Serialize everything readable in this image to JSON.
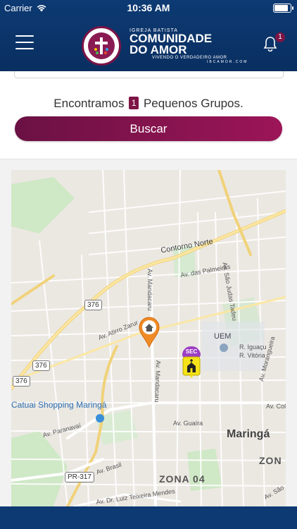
{
  "status_bar": {
    "carrier": "Carrier",
    "time": "10:36 AM",
    "battery_level": 0.95
  },
  "header": {
    "logo": {
      "small_text": "IGREJA BATISTA",
      "line1": "COMUNIDADE",
      "line2": "DO AMOR",
      "tagline": "VIVENDO O VERDADEIRO AMOR",
      "website": "IBCAMOR.COM"
    },
    "notifications_count": "1",
    "colors": {
      "primary": "#0d3a73",
      "accent": "#7d1446"
    }
  },
  "results": {
    "prefix": "Encontramos",
    "count": "1",
    "suffix": "Pequenos Grupos."
  },
  "search_button": {
    "label": "Buscar"
  },
  "map": {
    "labels": {
      "contorno_norte": "Contorno Norte",
      "av_palmeiras": "Av. das Palmeiras",
      "av_sao_judas": "Av. São Judas Tadeu",
      "av_mandacaru1": "Av. Mandacaru",
      "av_mandacaru2": "Av. Mandacaru",
      "av_atirro_zarur": "Av. Atirro Zarur",
      "uem": "UEM",
      "r_iguacu": "R. Iguaçu",
      "r_vitoria": "R. Vitória",
      "av_morangueira": "Av. Morangueira",
      "av_colom": "Av. Colom",
      "catuai": "Catuai Shopping Maringá",
      "av_paranavai": "Av. Paranavaí",
      "av_guaira": "Av. Guaíra",
      "maringa": "Maringá",
      "zona_04": "ZONA 04",
      "zona": "ZON",
      "av_brasil": "Av. Brasil",
      "av_dr_luiz": "Av. Dr. Luiz Teixeira Mendes",
      "av_sao": "Av. São"
    },
    "shields": {
      "r376a": "376",
      "r376b": "376",
      "r376c": "376",
      "pr317": "PR-317"
    },
    "marker_church_badge": "SEC"
  }
}
